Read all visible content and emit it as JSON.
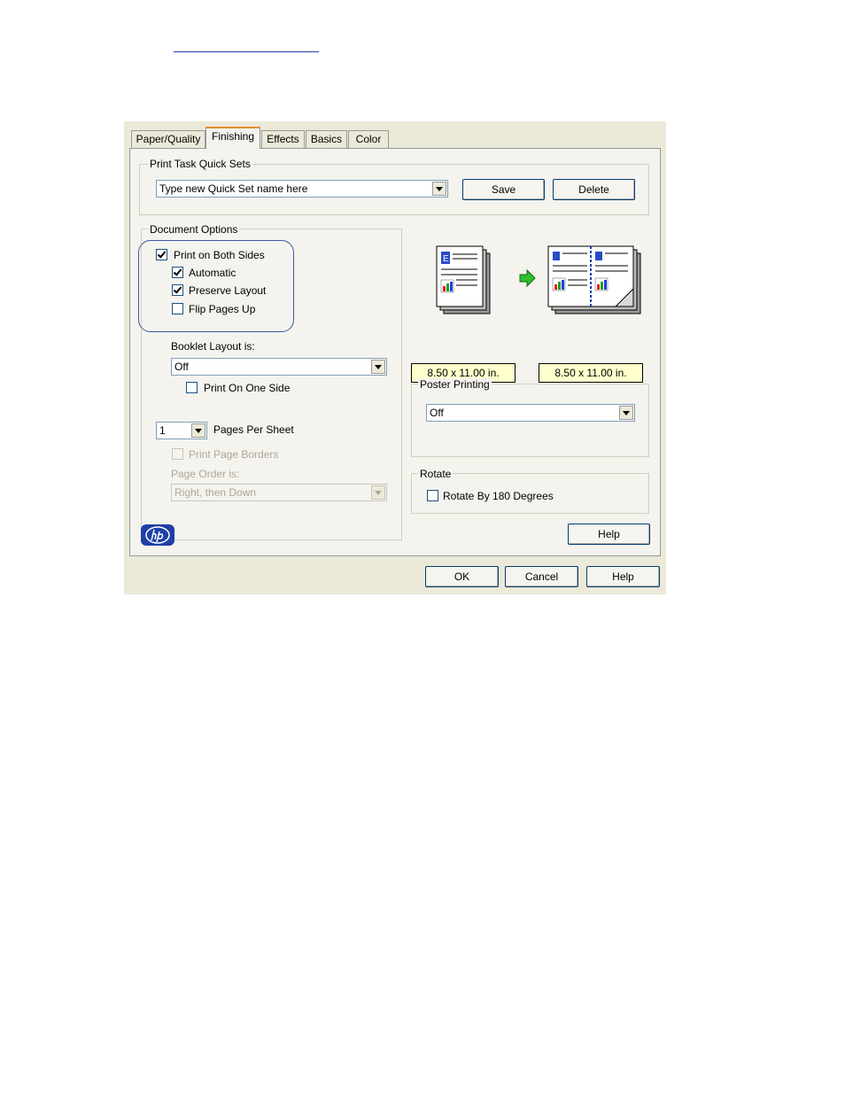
{
  "tabs": [
    "Paper/Quality",
    "Finishing",
    "Effects",
    "Basics",
    "Color"
  ],
  "quick_sets": {
    "group_label": "Print Task Quick Sets",
    "value": "Type new Quick Set name here",
    "save_label": "Save",
    "delete_label": "Delete"
  },
  "document_options": {
    "group_label": "Document Options",
    "print_both_sides": {
      "label": "Print on Both Sides",
      "checked": true
    },
    "automatic": {
      "label": "Automatic",
      "checked": true
    },
    "preserve_layout": {
      "label": "Preserve Layout",
      "checked": true
    },
    "flip_pages_up": {
      "label": "Flip Pages Up",
      "checked": false
    },
    "booklet_label": "Booklet Layout is:",
    "booklet_value": "Off",
    "print_one_side": {
      "label": "Print On One Side",
      "checked": false
    },
    "pages_per_sheet_value": "1",
    "pages_per_sheet_label": "Pages Per Sheet",
    "print_page_borders": {
      "label": "Print Page Borders",
      "checked": false,
      "disabled": true
    },
    "page_order_label": "Page Order is:",
    "page_order_value": "Right, then Down"
  },
  "preview": {
    "left_size": "8.50 x 11.00 in.",
    "right_size": "8.50 x 11.00 in."
  },
  "poster": {
    "group_label": "Poster Printing",
    "value": "Off"
  },
  "rotate": {
    "group_label": "Rotate",
    "rotate_180": {
      "label": "Rotate By 180 Degrees",
      "checked": false
    }
  },
  "panel_help_label": "Help",
  "footer": {
    "ok_label": "OK",
    "cancel_label": "Cancel",
    "help_label": "Help"
  },
  "colors": {
    "accent_tab": "#e68b2c",
    "highlight_ring": "#3a5aa0",
    "size_label_bg": "#ffffcc"
  }
}
